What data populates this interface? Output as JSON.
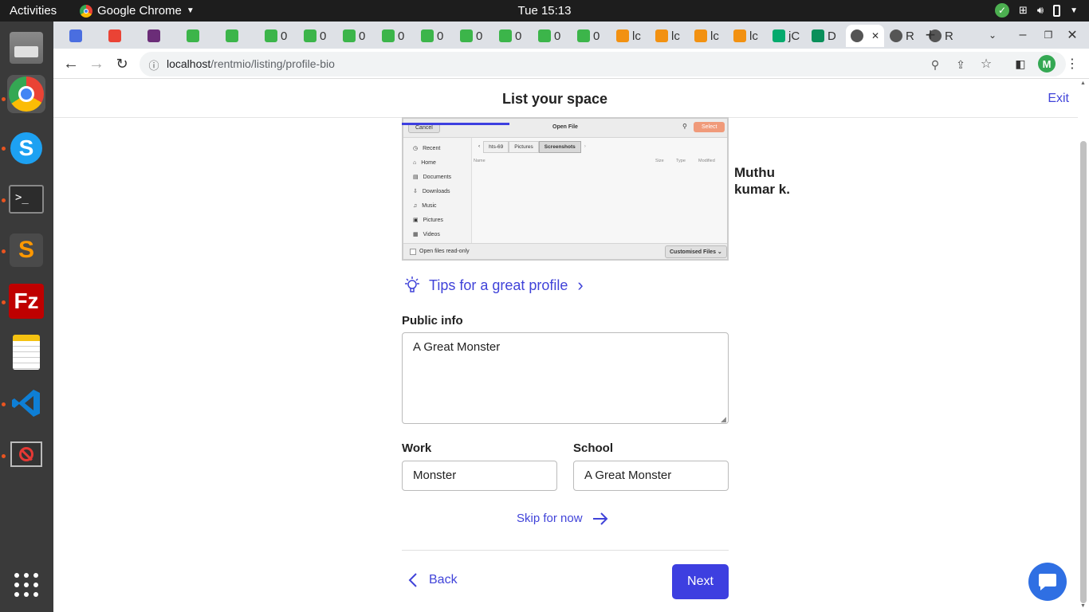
{
  "system": {
    "activities": "Activities",
    "app_name": "Google Chrome",
    "clock": "Tue 15:13"
  },
  "dock": {
    "apps": [
      "files-icon",
      "chrome-icon",
      "skype-icon",
      "terminal-icon",
      "sublime-icon",
      "filezilla-icon",
      "notes-icon",
      "vscode-icon",
      "disabled-app-icon",
      "app-grid-icon"
    ]
  },
  "browser": {
    "tabs": [
      {
        "label": "",
        "icon": "docs-icon",
        "color": "#4a6ee0"
      },
      {
        "label": "",
        "icon": "gmail-icon",
        "color": "#ea4335"
      },
      {
        "label": "",
        "icon": "slack-icon",
        "color": "#6b2d78"
      },
      {
        "label": "",
        "icon": "frog-icon",
        "color": "#3cb54a"
      },
      {
        "label": "",
        "icon": "frog-icon",
        "color": "#3cb54a"
      },
      {
        "label": "0",
        "icon": "frog-icon",
        "color": "#3cb54a"
      },
      {
        "label": "0",
        "icon": "frog-icon",
        "color": "#3cb54a"
      },
      {
        "label": "0",
        "icon": "frog-icon",
        "color": "#3cb54a"
      },
      {
        "label": "0",
        "icon": "frog-icon",
        "color": "#3cb54a"
      },
      {
        "label": "0",
        "icon": "frog-icon",
        "color": "#3cb54a"
      },
      {
        "label": "0",
        "icon": "frog-icon",
        "color": "#3cb54a"
      },
      {
        "label": "0",
        "icon": "frog-icon",
        "color": "#3cb54a"
      },
      {
        "label": "0",
        "icon": "frog-icon",
        "color": "#3cb54a"
      },
      {
        "label": "0",
        "icon": "frog-icon",
        "color": "#3cb54a"
      },
      {
        "label": "lc",
        "icon": "pma-icon",
        "color": "#f29111"
      },
      {
        "label": "lc",
        "icon": "pma-icon",
        "color": "#f29111"
      },
      {
        "label": "lc",
        "icon": "pma-icon",
        "color": "#f29111"
      },
      {
        "label": "lc",
        "icon": "pma-icon",
        "color": "#f29111"
      },
      {
        "label": "jC",
        "icon": "w3-icon",
        "color": "#04aa6d"
      },
      {
        "label": "D",
        "icon": "infinity-icon",
        "color": "#0a8f5a"
      },
      {
        "label": "",
        "icon": "globe-icon",
        "color": "#555"
      },
      {
        "label": "R",
        "icon": "globe-icon",
        "color": "#555"
      },
      {
        "label": "R",
        "icon": "globe-icon",
        "color": "#555"
      }
    ],
    "url_host": "localhost",
    "url_path": "/rentmio/listing/profile-bio",
    "profile_initial": "M"
  },
  "page": {
    "header_title": "List your space",
    "exit_label": "Exit",
    "upload_progress": 0.33,
    "user_name": "Muthu kumar k.",
    "tips_label": "Tips for a great profile",
    "public_info_label": "Public info",
    "public_info_value": "A Great Monster",
    "work_label": "Work",
    "work_value": "Monster",
    "school_label": "School",
    "school_value": "A Great Monster",
    "skip_label": "Skip for now",
    "back_label": "Back",
    "next_label": "Next"
  },
  "preview": {
    "cancel": "Cancel",
    "dialog_title": "Open File",
    "select": "Select",
    "crumbs": [
      "hts-69",
      "Pictures",
      "Screenshots"
    ],
    "places": [
      "Recent",
      "Home",
      "Documents",
      "Downloads",
      "Music",
      "Pictures",
      "Videos"
    ],
    "columns": [
      "Name",
      "Size",
      "Type",
      "Modified"
    ],
    "readonly": "Open files read-only",
    "filter": "Customised Files"
  },
  "colors": {
    "accent": "#3d3fe0",
    "link": "#4043d9",
    "dock_bg": "#3a3a3a",
    "chat_bubble": "#2f6fe3"
  }
}
